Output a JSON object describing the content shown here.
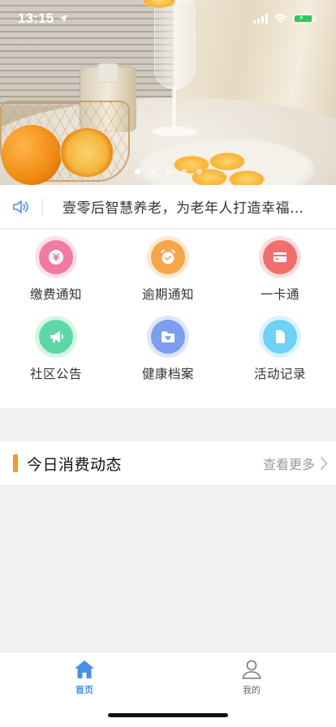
{
  "status_bar": {
    "time": "13:15"
  },
  "banner": {
    "slide_count": 5,
    "active_slide": 0
  },
  "notice": {
    "text": "壹零后智慧养老，为老年人打造幸福…"
  },
  "grid": [
    {
      "label": "缴费通知",
      "icon": "yen-coin-icon",
      "color": "#f07aa2"
    },
    {
      "label": "逾期通知",
      "icon": "alarm-clock-icon",
      "color": "#f5a54a"
    },
    {
      "label": "一卡通",
      "icon": "card-icon",
      "color": "#ef6f6f"
    },
    {
      "label": "社区公告",
      "icon": "megaphone-icon",
      "color": "#5fd8a8"
    },
    {
      "label": "健康档案",
      "icon": "health-folder-icon",
      "color": "#7d9ef0"
    },
    {
      "label": "活动记录",
      "icon": "document-icon",
      "color": "#6ed1f5"
    }
  ],
  "section": {
    "title": "今日消费动态",
    "more": "查看更多"
  },
  "tabbar": {
    "home": {
      "label": "首页",
      "active": true
    },
    "mine": {
      "label": "我的",
      "active": false
    }
  },
  "colors": {
    "accent": "#4a90e2",
    "section_bar": "#f29a2e"
  }
}
